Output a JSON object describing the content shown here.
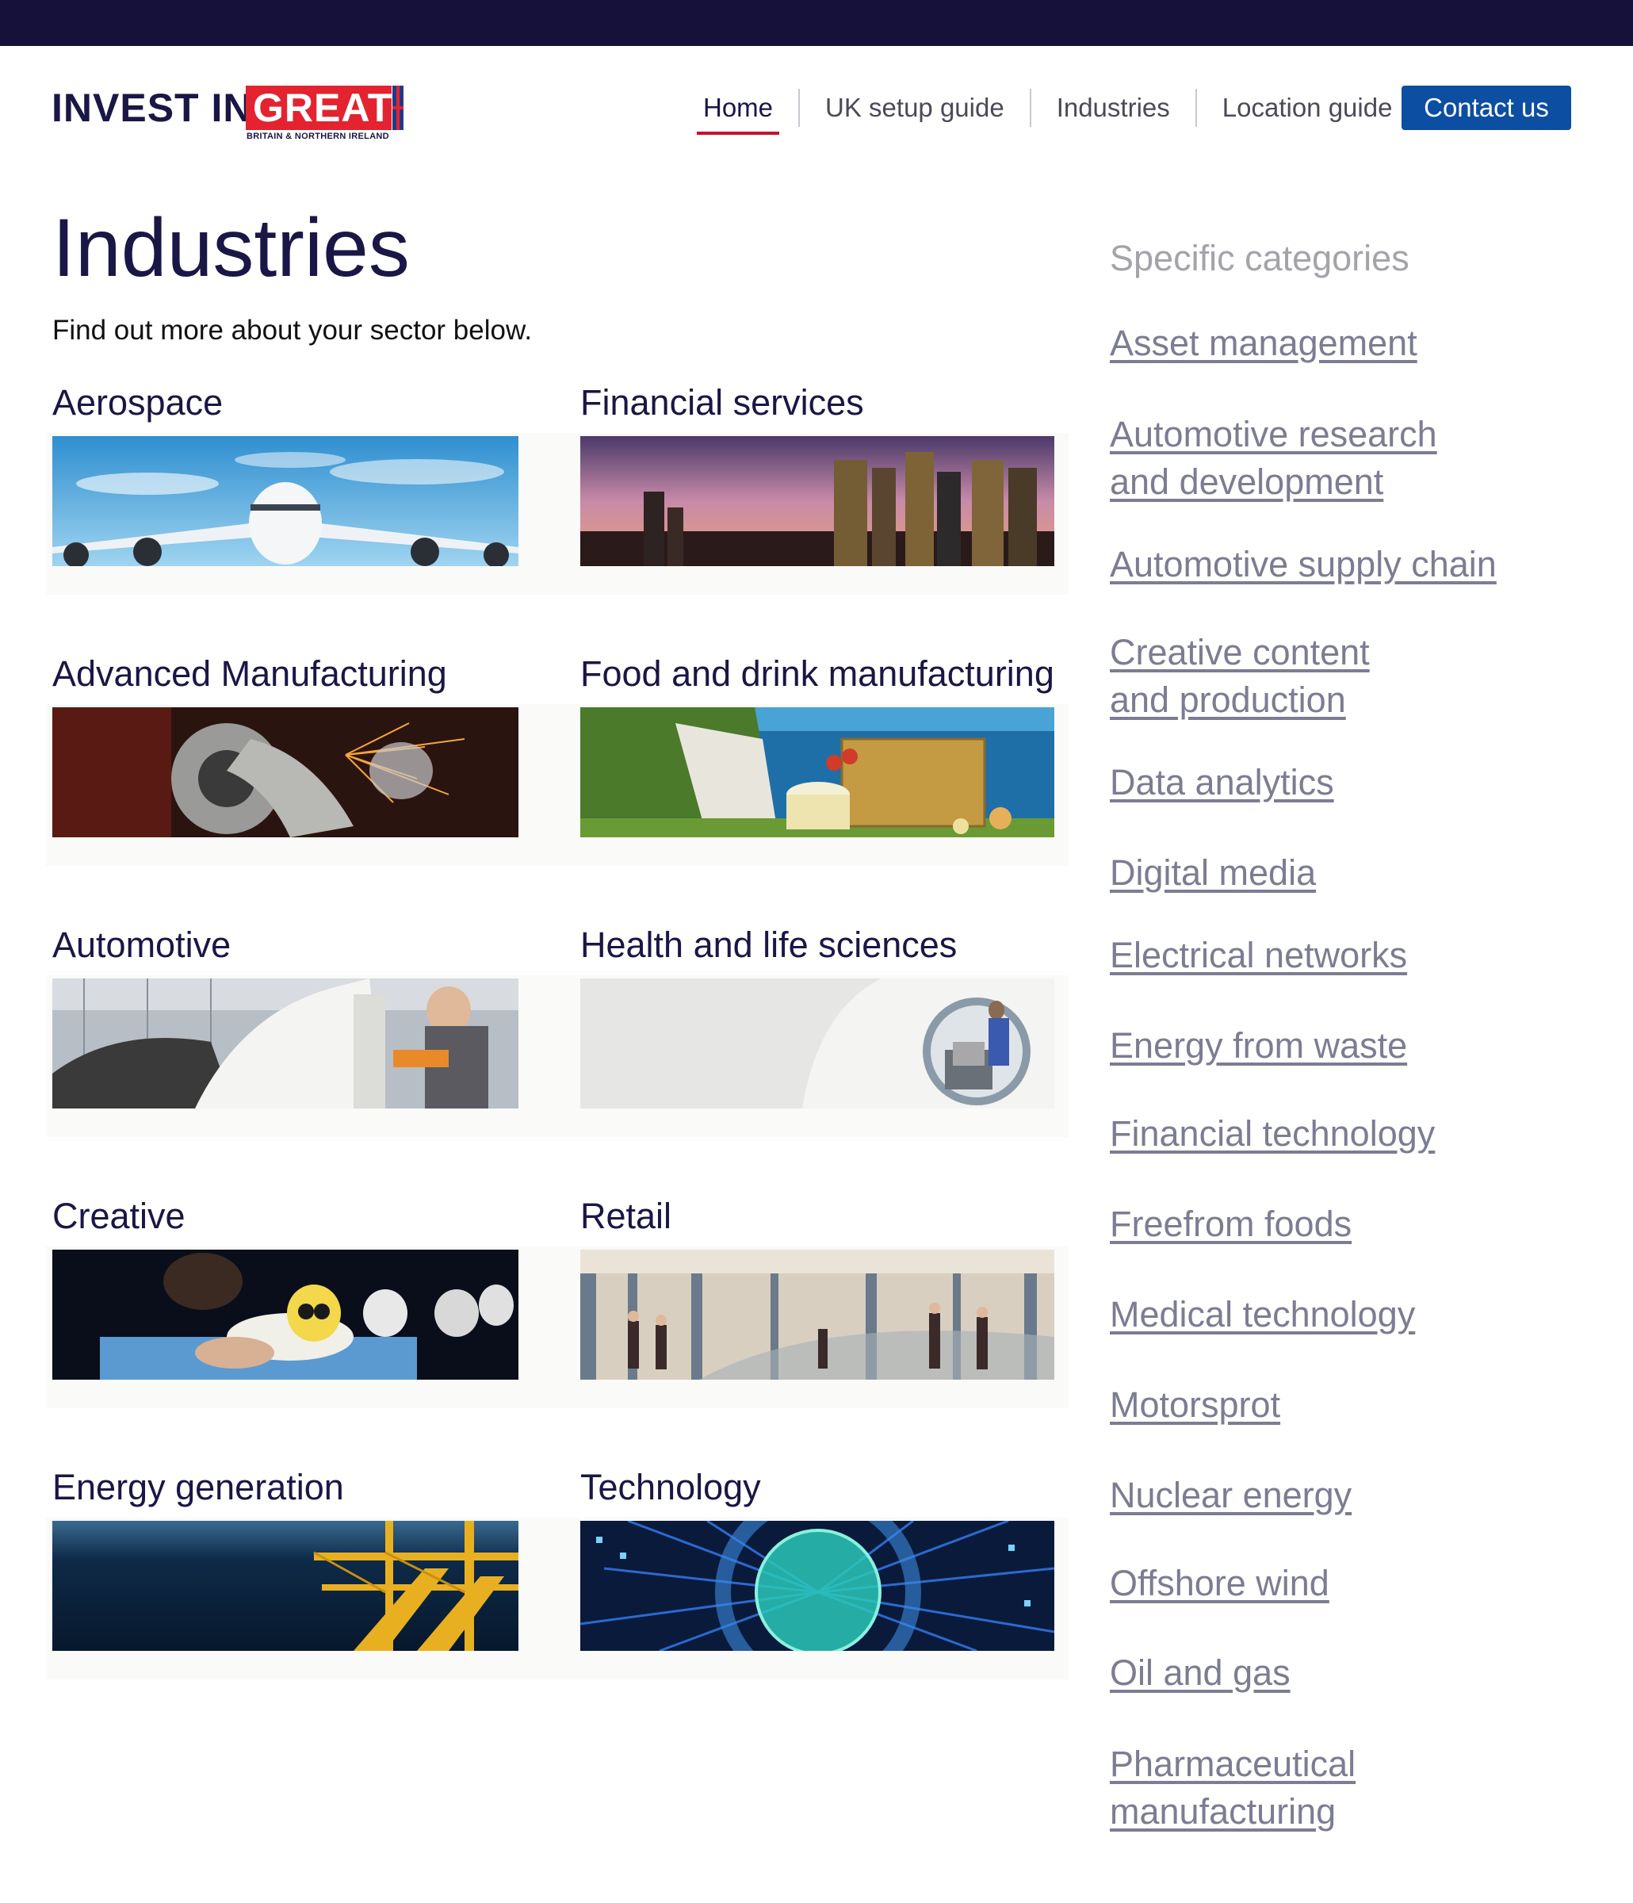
{
  "brand": {
    "logo_prefix": "INVEST IN",
    "logo_highlight": "GREAT",
    "logo_sub": "BRITAIN & NORTHERN IRELAND",
    "accent_red": "#e3232f",
    "navy": "#1a1646",
    "button_blue": "#0b4ea2",
    "topbar": "#16113b"
  },
  "nav": {
    "items": [
      {
        "label": "Home",
        "active": true
      },
      {
        "label": "UK setup guide",
        "active": false
      },
      {
        "label": "Industries",
        "active": false
      },
      {
        "label": "Location guide",
        "active": false
      }
    ],
    "contact_label": "Contact us"
  },
  "main": {
    "title": "Industries",
    "intro": "Find out more about your sector below.",
    "sectors": [
      {
        "label": "Aerospace",
        "image": "airliner-sky-image"
      },
      {
        "label": "Financial services",
        "image": "city-skyline-image"
      },
      {
        "label": "Advanced Manufacturing",
        "image": "metal-grinding-sparks-image"
      },
      {
        "label": "Food and drink manufacturing",
        "image": "picnic-cliffs-image"
      },
      {
        "label": "Automotive",
        "image": "car-factory-worker-image"
      },
      {
        "label": "Health and life sciences",
        "image": "mri-scanner-image"
      },
      {
        "label": "Creative",
        "image": "animation-figures-image"
      },
      {
        "label": "Retail",
        "image": "shopping-mall-image"
      },
      {
        "label": "Energy generation",
        "image": "offshore-platform-image"
      },
      {
        "label": "Technology",
        "image": "circuit-disc-image"
      }
    ]
  },
  "sidebar": {
    "heading": "Specific categories",
    "links": [
      {
        "lines": [
          "Asset management"
        ]
      },
      {
        "lines": [
          "Automotive research",
          "and development"
        ]
      },
      {
        "lines": [
          "Automotive supply chain"
        ]
      },
      {
        "lines": [
          "Creative content",
          "and production"
        ]
      },
      {
        "lines": [
          "Data analytics"
        ]
      },
      {
        "lines": [
          "Digital media"
        ]
      },
      {
        "lines": [
          "Electrical networks"
        ]
      },
      {
        "lines": [
          "Energy from waste"
        ]
      },
      {
        "lines": [
          "Financial technology"
        ]
      },
      {
        "lines": [
          "Freefrom foods"
        ]
      },
      {
        "lines": [
          "Medical technology"
        ]
      },
      {
        "lines": [
          "Motorsprot"
        ]
      },
      {
        "lines": [
          "Nuclear energy"
        ]
      },
      {
        "lines": [
          "Offshore wind"
        ]
      },
      {
        "lines": [
          "Oil and gas"
        ]
      },
      {
        "lines": [
          "Pharmaceutical",
          "manufacturing"
        ]
      }
    ]
  }
}
